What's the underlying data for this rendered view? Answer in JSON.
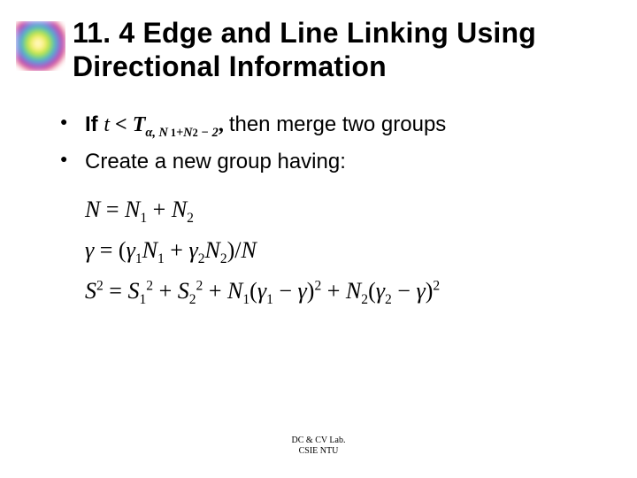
{
  "title": "11. 4 Edge and Line Linking Using Directional Information",
  "bullets": {
    "b1_prefix": "If ",
    "b1_var_t": "t",
    "b1_lt": " < ",
    "b1_T": "T",
    "b1_sub_alpha": "α",
    "b1_sub_comma": ", ",
    "b1_sub_N1plusN2m2": "N",
    "b1_sub_one": "1",
    "b1_sub_plus": "+",
    "b1_sub_N2": "N",
    "b1_sub_two": "2",
    "b1_sub_minus2": " − 2",
    "b1_suffix": " then merge two groups",
    "b2": "Create a new group having:"
  },
  "formulas": {
    "f1_lhs_N": "N",
    "f1_eq": " = ",
    "f1_N1": "N",
    "f1_one": "1",
    "f1_plus": " + ",
    "f1_N2": "N",
    "f1_two": "2",
    "f2_gamma": "γ",
    "f2_eq": " = (",
    "f2_g1": "γ",
    "f2_s1": "1",
    "f2_N1": "N",
    "f2_n1": "1",
    "f2_plus": " + ",
    "f2_g2": "γ",
    "f2_s2": "2",
    "f2_N2": "N",
    "f2_n2": "2",
    "f2_close": ")/",
    "f2_Nend": "N",
    "f3_S": "S",
    "f3_sup2a": "2",
    "f3_eq": " = ",
    "f3_S1": "S",
    "f3_s1": "1",
    "f3_sup2b": "2",
    "f3_plus1": " + ",
    "f3_S2": "S",
    "f3_s2": "2",
    "f3_sup2c": "2",
    "f3_plus2": " + ",
    "f3_N1": "N",
    "f3_n1": "1",
    "f3_open1": "(",
    "f3_g1": "γ",
    "f3_gs1": "1",
    "f3_minus1": " − ",
    "f3_g": "γ",
    "f3_close1": ")",
    "f3_sup2d": "2",
    "f3_plus3": " + ",
    "f3_N2": "N",
    "f3_n2": "2",
    "f3_open2": "(",
    "f3_g2": "γ",
    "f3_gs2": "2",
    "f3_minus2": " − ",
    "f3_ge": "γ",
    "f3_close2": ")",
    "f3_sup2e": "2"
  },
  "footer": {
    "line1": "DC & CV Lab.",
    "line2": "CSIE NTU"
  }
}
